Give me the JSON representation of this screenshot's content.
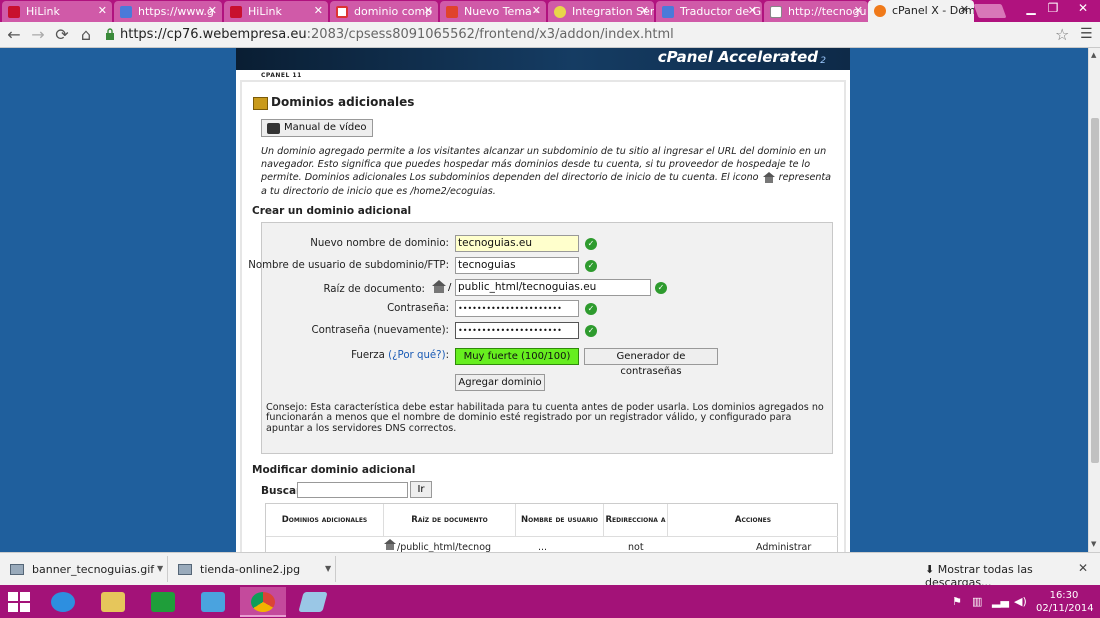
{
  "browser": {
    "tabs": [
      {
        "label": "HiLink",
        "icon": "hilink-icon"
      },
      {
        "label": "https://www.g",
        "icon": "google-icon"
      },
      {
        "label": "HiLink",
        "icon": "hilink-icon"
      },
      {
        "label": "dominio comp",
        "icon": "gmail-icon"
      },
      {
        "label": "Nuevo Tema -",
        "icon": "forum-icon"
      },
      {
        "label": "Integration Ser",
        "icon": "gear-icon"
      },
      {
        "label": "Traductor de G",
        "icon": "translate-icon"
      },
      {
        "label": "http://tecnogu",
        "icon": "page-icon"
      },
      {
        "label": "cPanel X - Dom",
        "icon": "cpanel-icon"
      }
    ],
    "url_host": "https://cp76.webempresa.eu",
    "url_rest": ":2083/cpsess8091065562/frontend/x3/addon/index.html"
  },
  "page": {
    "banner_text": "cPanel Accelerated",
    "banner_sub": "2",
    "cpanel_label": "CPANEL 11",
    "section_title": "Dominios adicionales",
    "video_button": "Manual de vídeo",
    "intro_part1": "Un dominio agregado permite a los visitantes alcanzar un subdominio de tu sitio al ingresar el URL del dominio en un navegador. Esto significa que puedes hospedar más dominios desde tu cuenta, si tu proveedor de hospedaje te lo permite. Dominios adicionales Los subdominios dependen del directorio de inicio de tu cuenta. El icono",
    "intro_part2": "representa a tu directorio de inicio que es /home2/ecoguias.",
    "create_title": "Crear un dominio adicional",
    "form": {
      "domain_label": "Nuevo nombre de dominio:",
      "domain_value": "tecnoguias.eu",
      "user_label": "Nombre de usuario de subdominio/FTP:",
      "user_value": "tecnoguias",
      "docroot_label": "Raíz de documento:",
      "docroot_prefix": "/",
      "docroot_value": "public_html/tecnoguias.eu",
      "password_label": "Contraseña:",
      "password_value": "••••••••••••••••••••••",
      "password2_label": "Contraseña (nuevamente):",
      "password2_value": "••••••••••••••••••••••",
      "strength_label": "Fuerza",
      "strength_link": "(¿Por qué?)",
      "strength_colon": ":",
      "strength_value": "Muy fuerte (100/100)",
      "generator_button": "Generador de contraseñas",
      "add_button": "Agregar dominio",
      "tip": "Consejo: Esta característica debe estar habilitada para tu cuenta antes de poder usarla. Los dominios agregados no funcionarán a menos que el nombre de dominio esté registrado por un registrador válido, y configurado para apuntar a los servidores DNS correctos."
    },
    "modify_title": "Modificar dominio adicional",
    "search_label": "Buscar",
    "search_value": "",
    "go_button": "Ir",
    "table": {
      "headers": [
        "Dominios adicionales",
        "Raíz de documento",
        "Nombre de usuario",
        "Redirecciona a",
        "Acciones"
      ],
      "row": {
        "docroot": "/public_html/tecnog",
        "username": "...",
        "redirect": "not",
        "action": "Administrar"
      }
    }
  },
  "downloads": {
    "items": [
      {
        "name": "banner_tecnoguias.gif"
      },
      {
        "name": "tienda-online2.jpg"
      }
    ],
    "show_all": "Mostrar todas las descargas..."
  },
  "taskbar": {
    "time": "16:30",
    "date": "02/11/2014"
  },
  "colors": {
    "tab_strip": "#b0127e",
    "page_bg": "#1f5f9d",
    "strength_bar": "#66ee1f",
    "ok_check": "#2e9b2e"
  }
}
